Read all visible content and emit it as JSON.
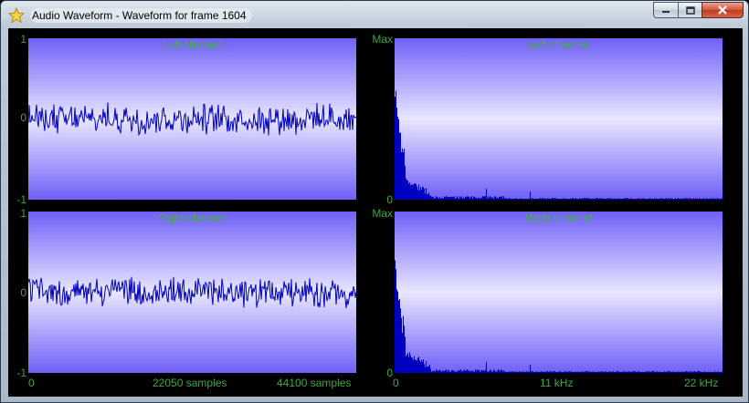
{
  "window": {
    "title": "Audio Waveform - Waveform for frame 1604",
    "icon": "star-icon",
    "buttons": {
      "minimize": "minimize-icon",
      "maximize": "maximize-icon",
      "close": "close-icon"
    },
    "accent_plot_edge": "#7060f8",
    "accent_plot_center": "#e8e6ff",
    "trace_color": "#0000c0",
    "label_color": "#40b040"
  },
  "waveform": {
    "y_top": "1",
    "y_mid": "0",
    "y_bottom": "-1",
    "x_labels": [
      "0",
      "22050 samples",
      "44100 samples"
    ],
    "left_title": "Left channel",
    "right_title": "Right channel"
  },
  "spectrum": {
    "y_top": "Max",
    "y_bottom": "0",
    "x_labels": [
      "0",
      "11 kHz",
      "22 kHz"
    ],
    "left_title": "Left channel",
    "right_title": "Right channel"
  },
  "chart_data": [
    {
      "type": "line",
      "title": "Left channel",
      "ylim": [
        -1,
        1
      ],
      "xlim": [
        0,
        44100
      ],
      "x_ticks": [
        "0",
        "22050 samples",
        "44100 samples"
      ],
      "description_series": "noise waveform, amplitude about ±0.2"
    },
    {
      "type": "line",
      "title": "Right channel",
      "ylim": [
        -1,
        1
      ],
      "xlim": [
        0,
        44100
      ],
      "x_ticks": [
        "0",
        "22050 samples",
        "44100 samples"
      ]
    },
    {
      "type": "bar",
      "title": "Left channel",
      "y_ticks": [
        "0",
        "Max"
      ],
      "x_ticks": [
        "0",
        "11 kHz",
        "22 kHz"
      ]
    },
    {
      "type": "bar",
      "title": "Right channel",
      "y_ticks": [
        "0",
        "Max"
      ],
      "x_ticks": [
        "0",
        "11 kHz",
        "22 kHz"
      ]
    }
  ]
}
